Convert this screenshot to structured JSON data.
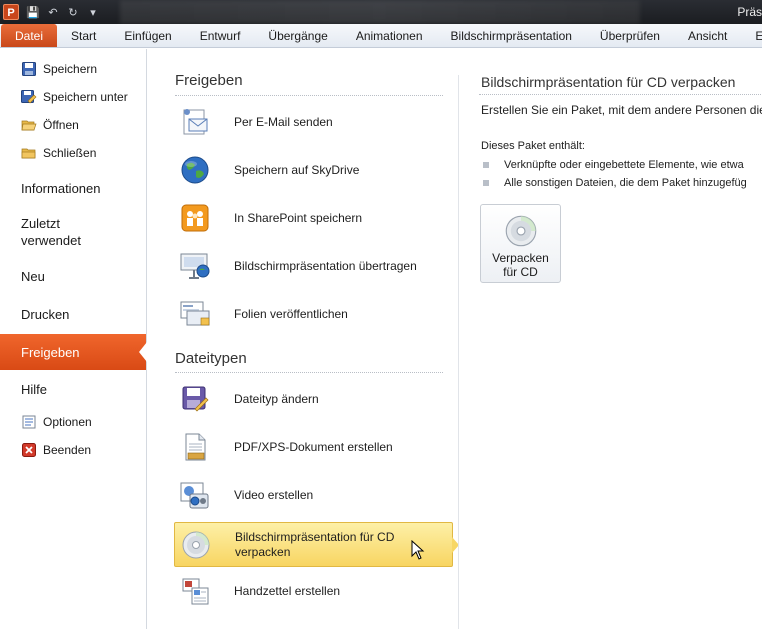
{
  "titlebar": {
    "app_icon_letter": "P",
    "window_title": "Präs",
    "qat": [
      {
        "icon": "save-icon",
        "glyph": "💾"
      },
      {
        "icon": "undo-icon",
        "glyph": "↶"
      },
      {
        "icon": "redo-icon",
        "glyph": "↻"
      },
      {
        "icon": "customize-qat-icon",
        "glyph": "▾"
      }
    ]
  },
  "ribbon": {
    "tabs": [
      "Datei",
      "Start",
      "Einfügen",
      "Entwurf",
      "Übergänge",
      "Animationen",
      "Bildschirmpräsentation",
      "Überprüfen",
      "Ansicht",
      "En"
    ]
  },
  "nav": {
    "speichern": "Speichern",
    "speichern_unter": "Speichern unter",
    "oeffnen": "Öffnen",
    "schliessen": "Schließen",
    "informationen": "Informationen",
    "zuletzt_1": "Zuletzt",
    "zuletzt_2": "verwendet",
    "neu": "Neu",
    "drucken": "Drucken",
    "freigeben": "Freigeben",
    "hilfe": "Hilfe",
    "optionen": "Optionen",
    "beenden": "Beenden"
  },
  "middle": {
    "section_share": "Freigeben",
    "section_filetypes": "Dateitypen",
    "email": "Per E-Mail senden",
    "skydrive": "Speichern auf SkyDrive",
    "sharepoint": "In SharePoint speichern",
    "broadcast": "Bildschirmpräsentation übertragen",
    "publish_slides": "Folien veröffentlichen",
    "change_type": "Dateityp ändern",
    "pdf": "PDF/XPS-Dokument erstellen",
    "video": "Video erstellen",
    "cd_1": "Bildschirmpräsentation für CD",
    "cd_2": "verpacken",
    "handouts": "Handzettel erstellen"
  },
  "right": {
    "title": "Bildschirmpräsentation für CD verpacken",
    "description": "Erstellen Sie ein Paket, mit dem andere Personen die P",
    "contains": "Dieses Paket enthält:",
    "bullet_1": "Verknüpfte oder eingebettete Elemente, wie etwa",
    "bullet_2": "Alle sonstigen Dateien, die dem Paket hinzugefüg",
    "button_1": "Verpacken",
    "button_2": "für CD"
  },
  "colors": {
    "accent_orange": "#e0541c",
    "selection_yellow": "#f9dc6d"
  }
}
